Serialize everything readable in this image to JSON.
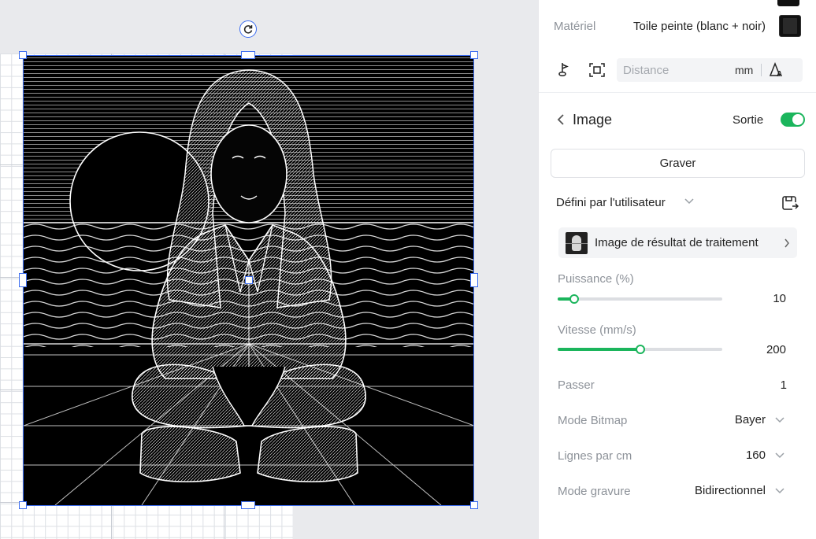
{
  "material": {
    "label": "Matériel",
    "value": "Toile peinte (blanc + noir)"
  },
  "distance": {
    "placeholder": "Distance",
    "unit": "mm"
  },
  "image_section": {
    "title": "Image",
    "output_label": "Sortie",
    "output_enabled": true,
    "mode_button": "Graver",
    "preset": "Défini par l'utilisateur",
    "result_image_label": "Image de résultat de traitement"
  },
  "params": {
    "power": {
      "label": "Puissance (%)",
      "value": "10",
      "fraction": 0.1
    },
    "speed": {
      "label": "Vitesse (mm/s)",
      "value": "200",
      "fraction": 0.5
    },
    "passes": {
      "label": "Passer",
      "value": "1"
    },
    "bitmap_mode": {
      "label": "Mode Bitmap",
      "value": "Bayer"
    },
    "lines_per_cm": {
      "label": "Lignes par cm",
      "value": "160"
    },
    "engrave_mode": {
      "label": "Mode gravure",
      "value": "Bidirectionnel"
    }
  },
  "colors": {
    "accent": "#1bb55c",
    "selection": "#3b6cf0"
  },
  "icons": [
    "rotate-icon",
    "focus-icon",
    "frame-scan-icon",
    "autofocus-icon",
    "chevron-left-icon",
    "chevron-down-icon",
    "chevron-right-icon",
    "export-icon"
  ]
}
